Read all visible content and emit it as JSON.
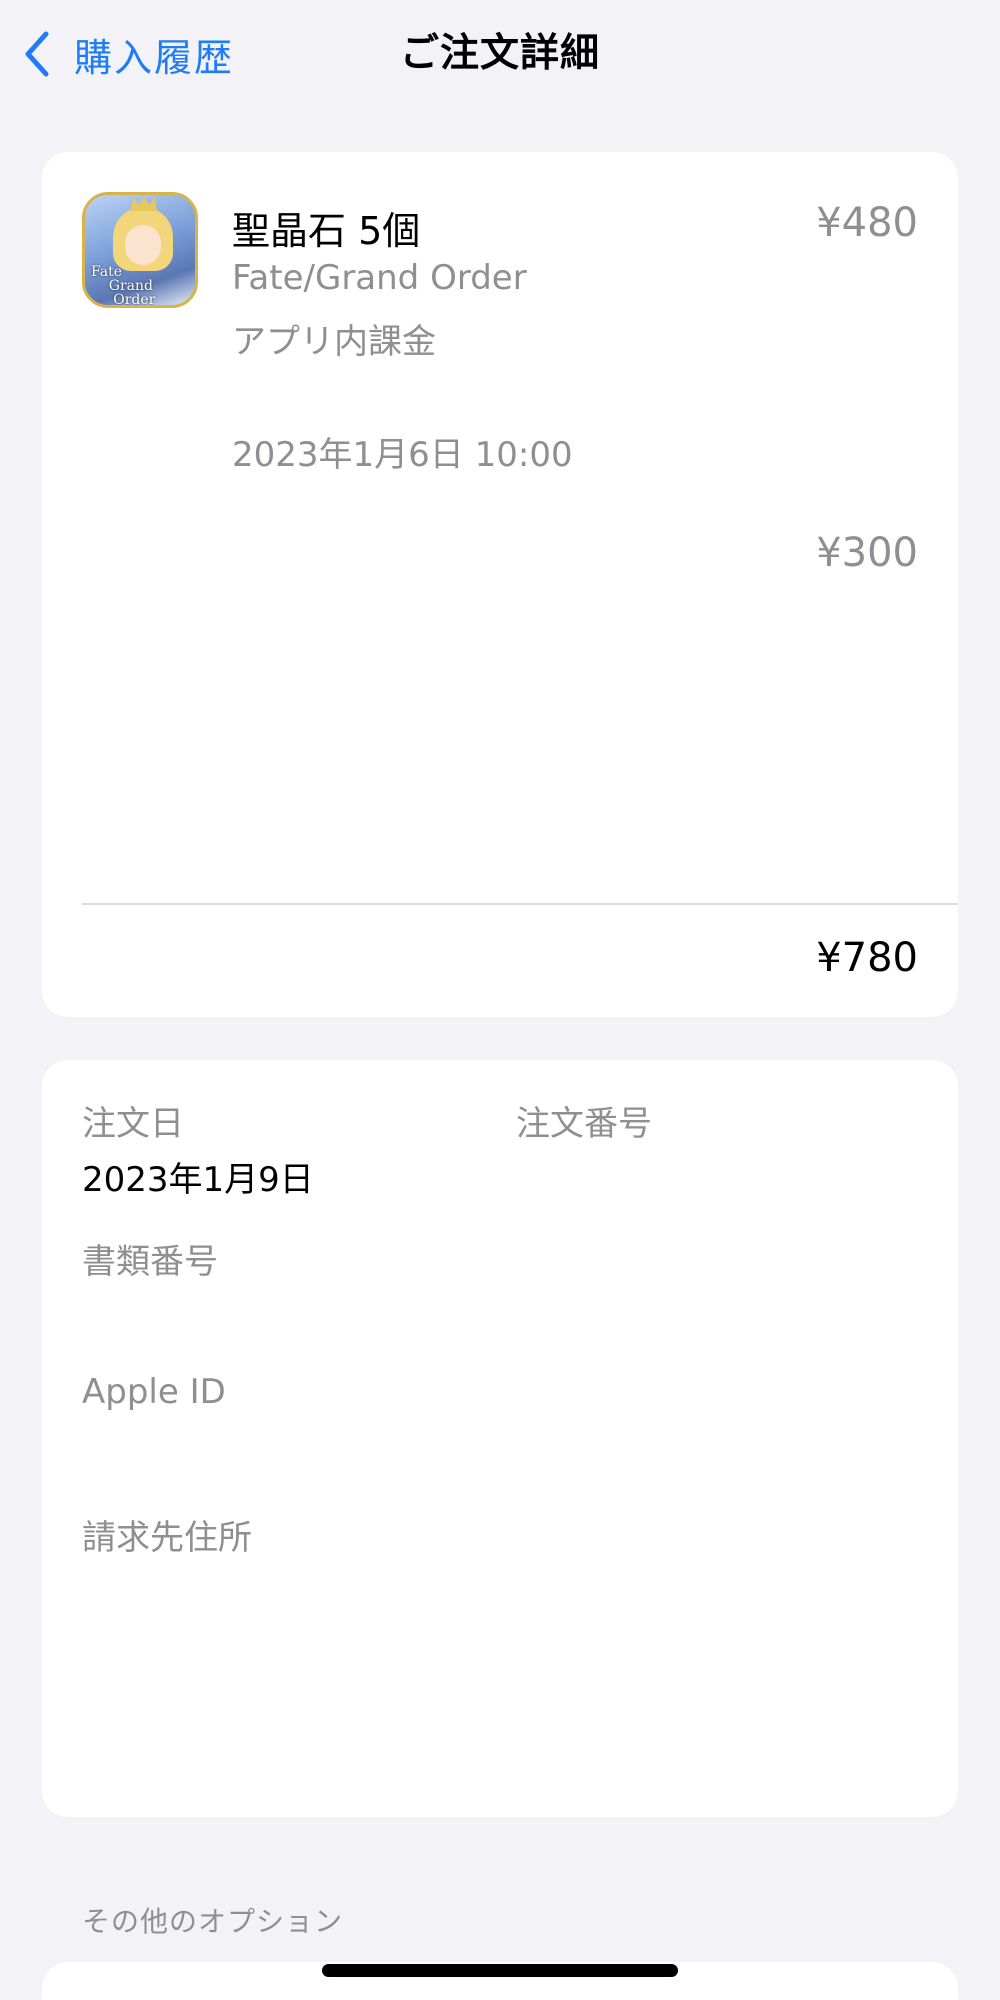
{
  "nav": {
    "back_label": "購入履歴",
    "title": "ご注文詳細"
  },
  "purchase": {
    "items": [
      {
        "title": "聖晶石 5個",
        "app_name": "Fate/Grand Order",
        "type": "アプリ内課金",
        "date": "2023年1月6日 10:00",
        "price": "¥480",
        "icon": "fate-grand-order-app-icon"
      },
      {
        "price": "¥300"
      }
    ],
    "total": "¥780"
  },
  "order_info": {
    "order_date_label": "注文日",
    "order_date_value": "2023年1月9日",
    "order_number_label": "注文番号",
    "document_number_label": "書類番号",
    "apple_id_label": "Apple ID",
    "billing_address_label": "請求先住所"
  },
  "options": {
    "header": "その他のオプション"
  },
  "colors": {
    "accent": "#1f7cf6",
    "background": "#f2f2f7",
    "card": "#ffffff",
    "secondary_text": "#8e8e93"
  }
}
